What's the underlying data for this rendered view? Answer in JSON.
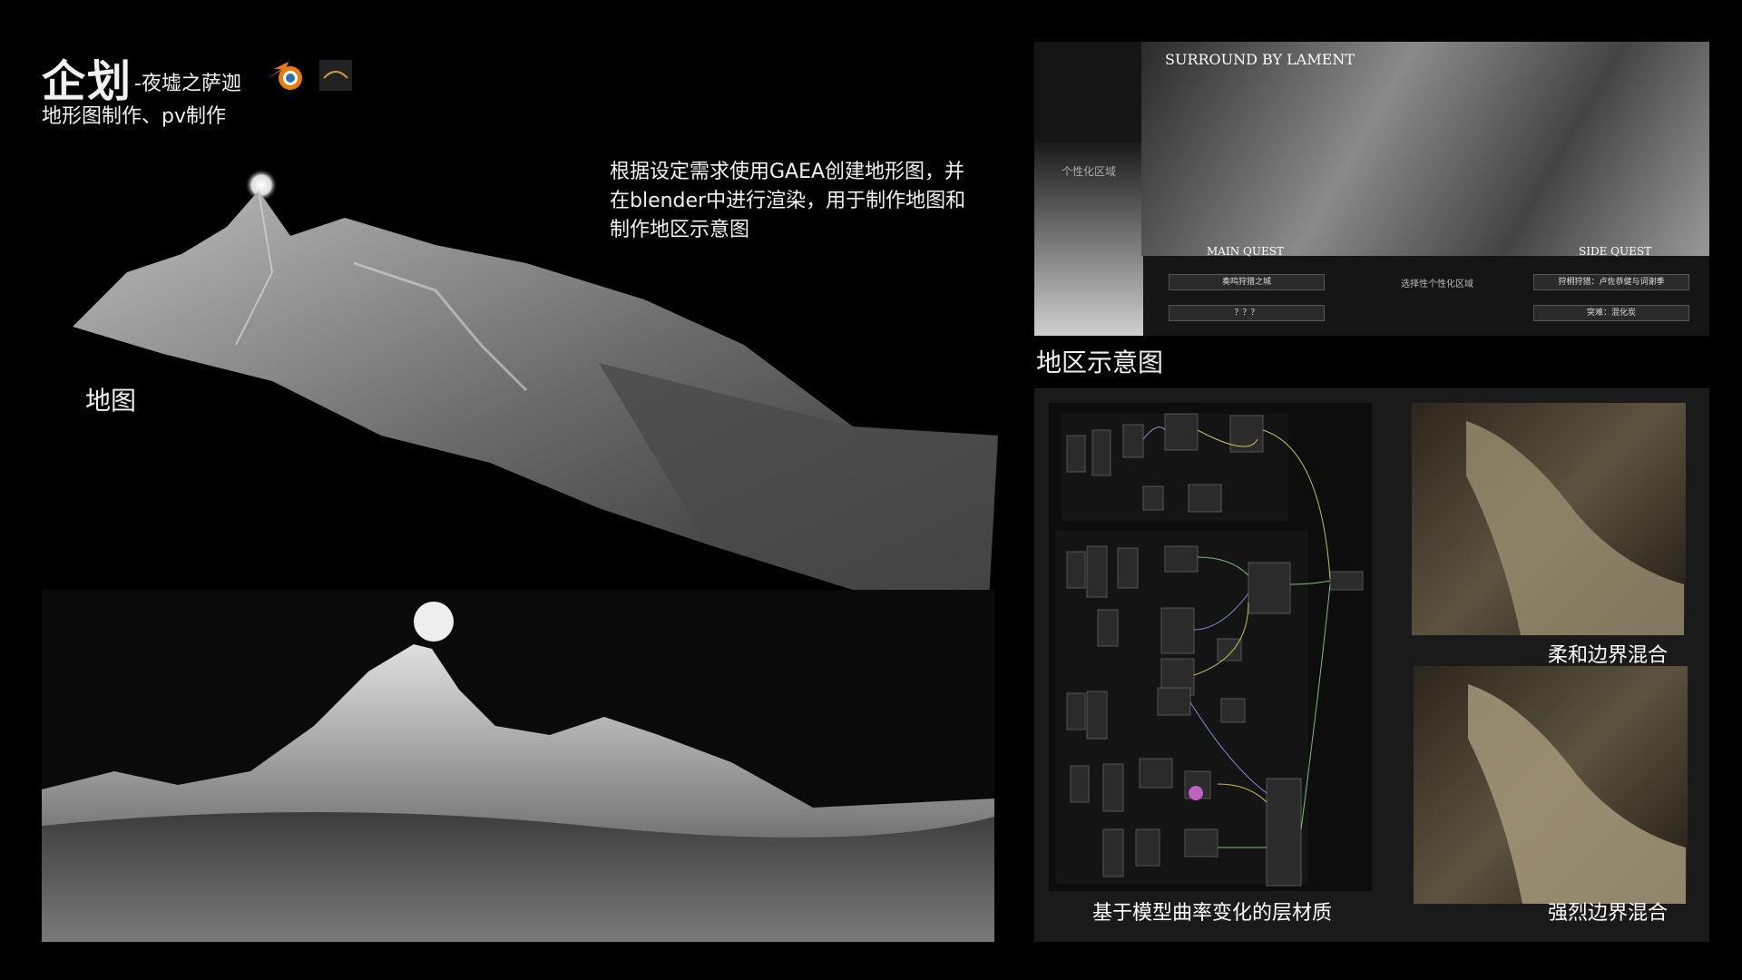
{
  "header": {
    "title": "企划",
    "subtitle": "-夜墟之萨迦",
    "subtitle2": "地形图制作、pv制作"
  },
  "icons": {
    "blender": "blender-logo-icon",
    "gaea": "gaea-logo-icon"
  },
  "description": {
    "line1": "根据设定需求使用GAEA创建地形图，并",
    "line2": "在blender中进行渲染，用于制作地图和",
    "line3": "制作地区示意图"
  },
  "labels": {
    "map": "地图",
    "region_diagram": "地区示意图",
    "layer_material": "基于模型曲率变化的层材质",
    "soft_blend": "柔和边界混合",
    "hard_blend": "强烈边界混合"
  },
  "region_ui": {
    "title": "SURROUND BY LAMENT",
    "side_title": "个性化区域",
    "main_quest": "MAIN QUEST",
    "side_quest": "SIDE QUEST",
    "center_label": "选择性个性化区域",
    "row1_left": "奏鸣狩猎之城",
    "row1_right": "狩桐狩猎：卢佐恭健与词谢季",
    "row2_left": "？？？",
    "row2_right": "突难：混化炭"
  },
  "colors": {
    "accent_blender": "#e87d0d",
    "background": "#000000",
    "panel": "#1a1a1a"
  }
}
